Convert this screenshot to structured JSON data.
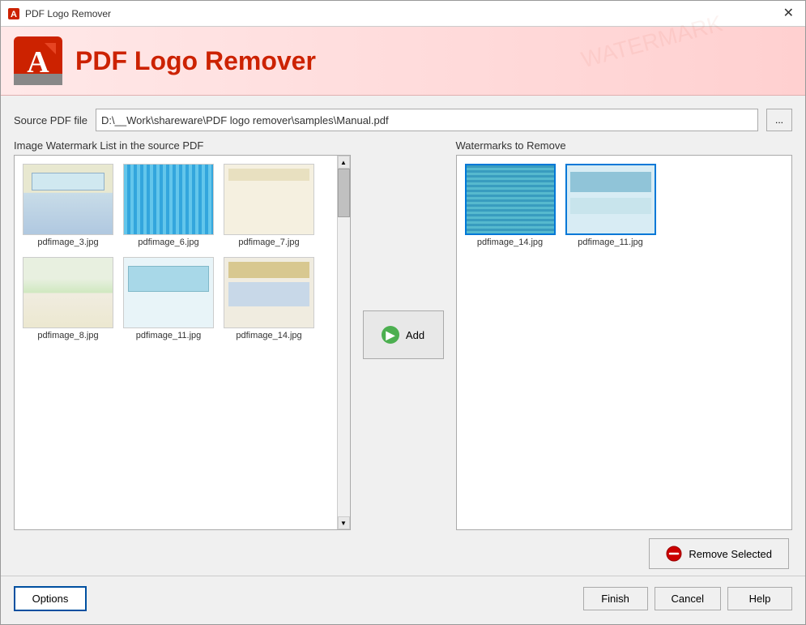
{
  "window": {
    "title": "PDF Logo Remover",
    "close_label": "✕"
  },
  "header": {
    "title": "PDF Logo Remover"
  },
  "source": {
    "label": "Source PDF file",
    "value": "D:\\__Work\\shareware\\PDF logo remover\\samples\\Manual.pdf",
    "browse_label": "..."
  },
  "left_panel": {
    "label": "Image Watermark List in the source PDF",
    "images": [
      {
        "id": "pdfimage_3",
        "filename": "pdfimage_3.jpg"
      },
      {
        "id": "pdfimage_6",
        "filename": "pdfimage_6.jpg"
      },
      {
        "id": "pdfimage_7",
        "filename": "pdfimage_7.jpg"
      },
      {
        "id": "pdfimage_8",
        "filename": "pdfimage_8.jpg"
      },
      {
        "id": "pdfimage_11",
        "filename": "pdfimage_11.jpg"
      },
      {
        "id": "pdfimage_14",
        "filename": "pdfimage_14.jpg"
      }
    ]
  },
  "add_button": {
    "label": "Add"
  },
  "right_panel": {
    "label": "Watermarks to Remove",
    "images": [
      {
        "id": "pdfimage_14",
        "filename": "pdfimage_14.jpg"
      },
      {
        "id": "pdfimage_11",
        "filename": "pdfimage_11.jpg"
      }
    ]
  },
  "remove_button": {
    "label": "Remove Selected"
  },
  "footer": {
    "options_label": "Options",
    "finish_label": "Finish",
    "cancel_label": "Cancel",
    "help_label": "Help"
  }
}
